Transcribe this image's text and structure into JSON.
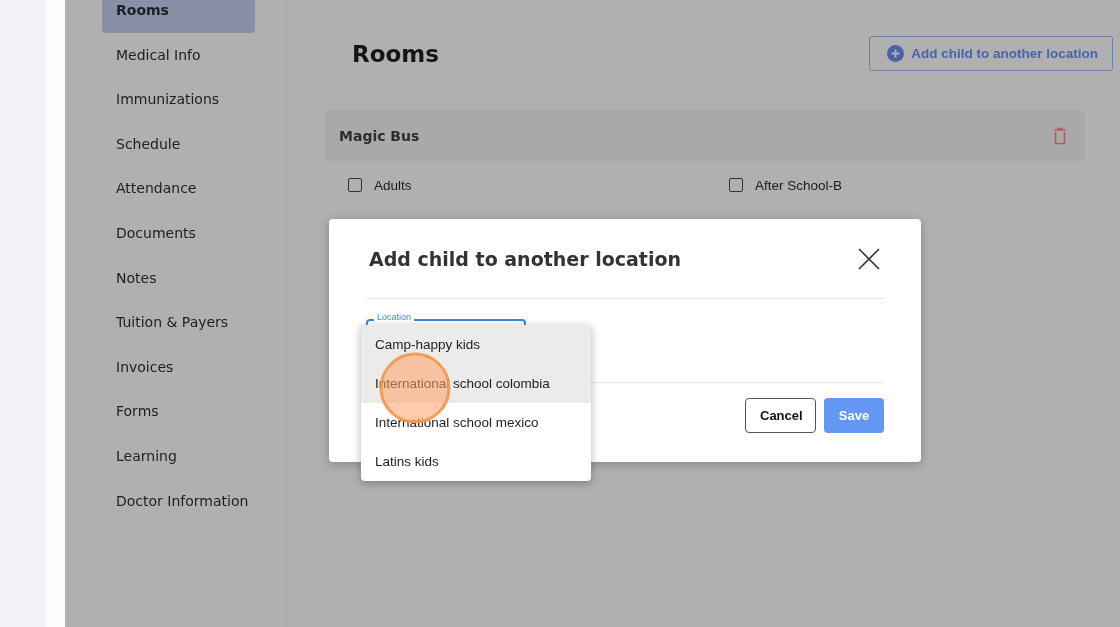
{
  "sidebar": {
    "items": [
      {
        "label": "Rooms",
        "selected": true
      },
      {
        "label": "Medical Info",
        "selected": false
      },
      {
        "label": "Immunizations",
        "selected": false
      },
      {
        "label": "Schedule",
        "selected": false
      },
      {
        "label": "Attendance",
        "selected": false
      },
      {
        "label": "Documents",
        "selected": false
      },
      {
        "label": "Notes",
        "selected": false
      },
      {
        "label": "Tuition & Payers",
        "selected": false
      },
      {
        "label": "Invoices",
        "selected": false
      },
      {
        "label": "Forms",
        "selected": false
      },
      {
        "label": "Learning",
        "selected": false
      },
      {
        "label": "Doctor Information",
        "selected": false
      }
    ]
  },
  "page": {
    "title": "Rooms",
    "add_button": "Add child to another location"
  },
  "location_group": {
    "name": "Magic Bus",
    "rooms": [
      {
        "label": "Adults",
        "checked": false
      },
      {
        "label": "After School-B",
        "checked": false
      }
    ]
  },
  "dialog": {
    "title": "Add child to another location",
    "field_label": "Location",
    "options": [
      {
        "label": "Camp-happy kids",
        "highlighted": true
      },
      {
        "label": "International school colombia",
        "highlighted": true
      },
      {
        "label": "International school mexico",
        "highlighted": false
      },
      {
        "label": "Latins kids",
        "highlighted": false
      }
    ],
    "buttons": [
      {
        "label": "Cancel",
        "kind": "secondary"
      },
      {
        "label": "Save",
        "kind": "primary"
      }
    ]
  }
}
